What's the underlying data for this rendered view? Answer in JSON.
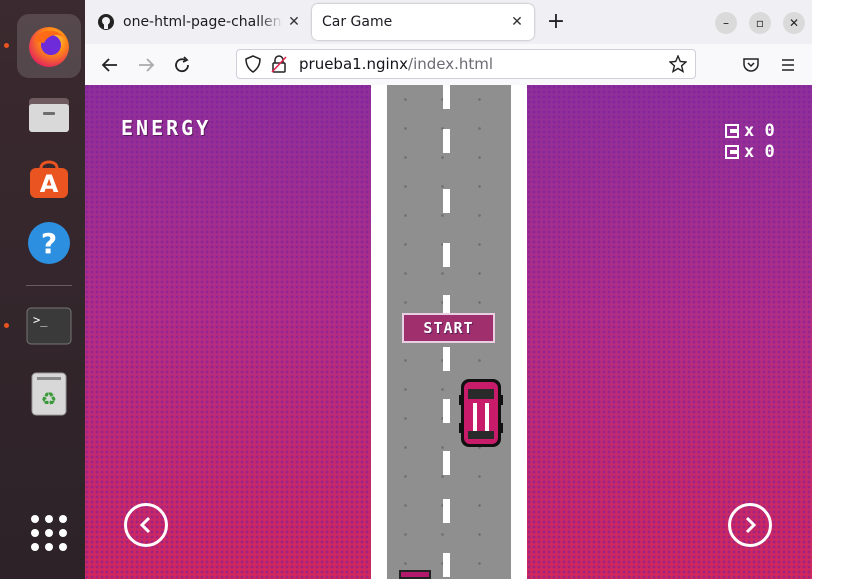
{
  "browser": {
    "tabs": [
      {
        "title": "one-html-page-challenge",
        "icon": "github-icon"
      },
      {
        "title": "Car Game",
        "icon": "none"
      }
    ],
    "url": {
      "host": "prueba1.nginx",
      "path": "/index.html"
    }
  },
  "dock": {
    "apps": [
      "firefox",
      "files",
      "app-center",
      "help",
      "terminal",
      "trash"
    ]
  },
  "game": {
    "energy_label": "ENERGY",
    "counters": [
      {
        "label": "x 0"
      },
      {
        "label": "x 0"
      }
    ],
    "start_label": "START"
  }
}
